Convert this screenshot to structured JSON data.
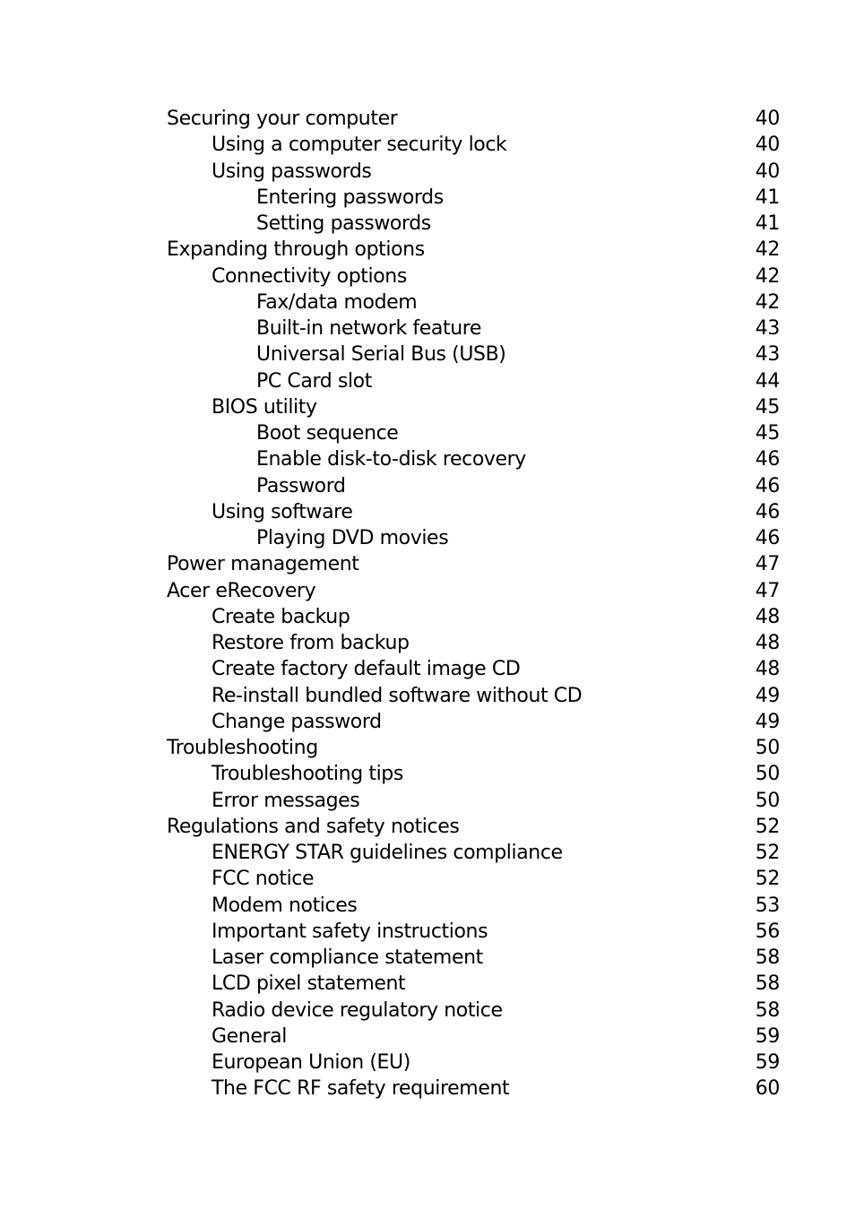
{
  "toc": {
    "entries": [
      {
        "title": "Securing your computer",
        "page": "40",
        "level": 0
      },
      {
        "title": "Using a computer security lock",
        "page": "40",
        "level": 1
      },
      {
        "title": "Using passwords",
        "page": "40",
        "level": 1
      },
      {
        "title": "Entering passwords",
        "page": "41",
        "level": 2
      },
      {
        "title": "Setting passwords",
        "page": "41",
        "level": 2
      },
      {
        "title": "Expanding through options",
        "page": "42",
        "level": 0
      },
      {
        "title": "Connectivity options",
        "page": "42",
        "level": 1
      },
      {
        "title": "Fax/data modem",
        "page": "42",
        "level": 2
      },
      {
        "title": "Built-in network feature",
        "page": "43",
        "level": 2
      },
      {
        "title": "Universal Serial Bus (USB)",
        "page": "43",
        "level": 2
      },
      {
        "title": "PC Card slot",
        "page": "44",
        "level": 2
      },
      {
        "title": "BIOS utility",
        "page": "45",
        "level": 1
      },
      {
        "title": "Boot sequence",
        "page": "45",
        "level": 2
      },
      {
        "title": "Enable disk-to-disk recovery",
        "page": "46",
        "level": 2
      },
      {
        "title": "Password",
        "page": "46",
        "level": 2
      },
      {
        "title": "Using software",
        "page": "46",
        "level": 1
      },
      {
        "title": "Playing DVD movies",
        "page": "46",
        "level": 2
      },
      {
        "title": "Power management",
        "page": "47",
        "level": 0
      },
      {
        "title": "Acer eRecovery",
        "page": "47",
        "level": 0
      },
      {
        "title": "Create backup",
        "page": "48",
        "level": 1
      },
      {
        "title": "Restore from backup",
        "page": "48",
        "level": 1
      },
      {
        "title": "Create factory default image CD",
        "page": "48",
        "level": 1
      },
      {
        "title": "Re-install bundled software without CD",
        "page": "49",
        "level": 1
      },
      {
        "title": "Change password",
        "page": "49",
        "level": 1
      },
      {
        "title": "Troubleshooting",
        "page": "50",
        "level": 0
      },
      {
        "title": "Troubleshooting tips",
        "page": "50",
        "level": 1
      },
      {
        "title": "Error messages",
        "page": "50",
        "level": 1
      },
      {
        "title": "Regulations and safety notices",
        "page": "52",
        "level": 0
      },
      {
        "title": "ENERGY STAR guidelines compliance",
        "page": "52",
        "level": 1
      },
      {
        "title": "FCC notice",
        "page": "52",
        "level": 1
      },
      {
        "title": "Modem notices",
        "page": "53",
        "level": 1
      },
      {
        "title": "Important safety instructions",
        "page": "56",
        "level": 1
      },
      {
        "title": "Laser compliance statement",
        "page": "58",
        "level": 1
      },
      {
        "title": "LCD pixel statement",
        "page": "58",
        "level": 1
      },
      {
        "title": "Radio device regulatory notice",
        "page": "58",
        "level": 1
      },
      {
        "title": "General",
        "page": "59",
        "level": 1
      },
      {
        "title": "European Union (EU)",
        "page": "59",
        "level": 1
      },
      {
        "title": "The FCC RF safety requirement",
        "page": "60",
        "level": 1
      }
    ]
  }
}
